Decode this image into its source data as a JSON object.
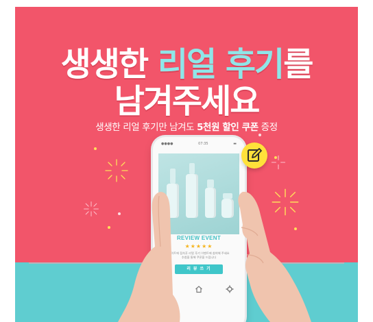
{
  "headline": {
    "line1_a": "생생한 ",
    "line1_accent": "리얼 후기",
    "line1_b": "를",
    "line2": "남겨주세요"
  },
  "subline": {
    "part1": "생생한 리얼 후기만 남겨도 ",
    "highlight": "5천원 할인 쿠폰",
    "part2": " 증정"
  },
  "phone": {
    "status_left": "●●●● ",
    "status_center": "07:35",
    "status_right": "▬",
    "review_title": "REVIEW EVENT",
    "stars": "★★★★★",
    "desc_line1": "사이트에 접속후 리얼 후기 이벤트에 참여해 주세요",
    "desc_line2": "추첨을 통해 쿠폰을 드립니다",
    "button_label": "리 뷰 쓰 기",
    "nav_share": "<",
    "nav_home": "⌂",
    "nav_settings": "✱"
  },
  "colors": {
    "background": "#f2556a",
    "accent_text": "#8fe6e8",
    "teal_band": "#5fcdd0",
    "badge": "#ffe13a",
    "button": "#3fc6c9",
    "stars": "#f5b51f"
  },
  "icons": {
    "edit": "pencil-edit-icon",
    "share": "share-icon",
    "home": "home-icon",
    "settings": "gear-icon"
  }
}
